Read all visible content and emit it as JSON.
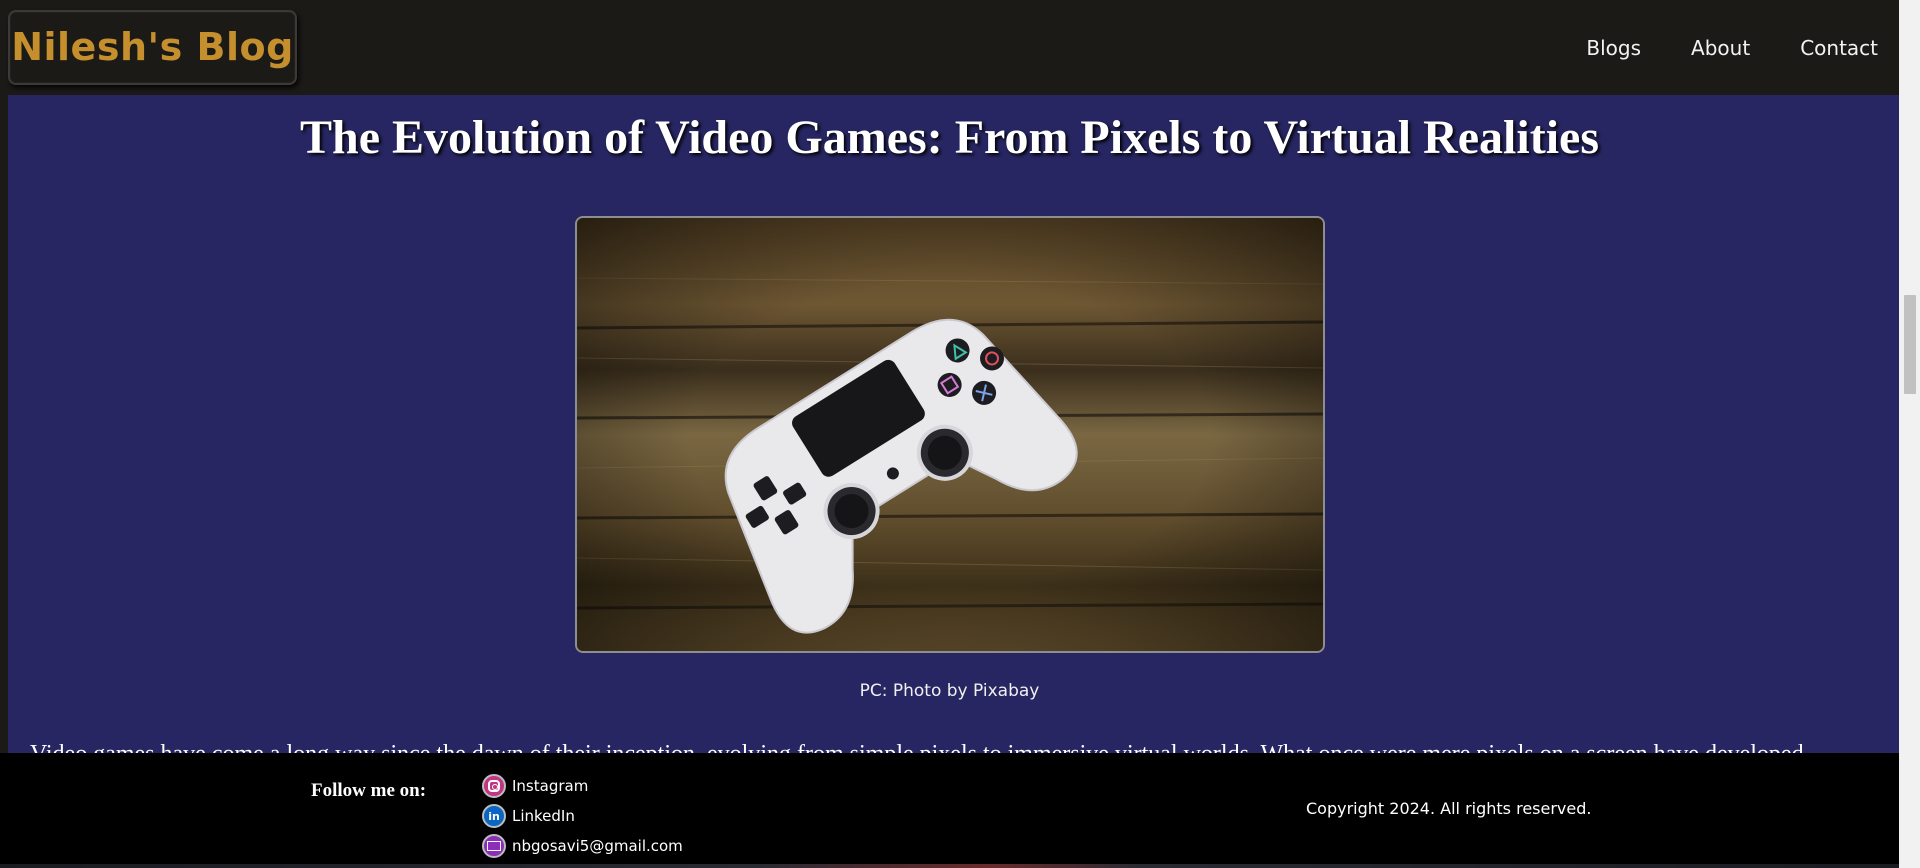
{
  "header": {
    "logo": "Nilesh's Blog",
    "nav": [
      {
        "label": "Blogs"
      },
      {
        "label": "About"
      },
      {
        "label": "Contact"
      }
    ]
  },
  "article": {
    "title": "The Evolution of Video Games: From Pixels to Virtual Realities",
    "image_alt": "White game controller on a wooden table",
    "caption": "PC: Photo by Pixabay",
    "body_cut_text": "Video games have come a long way since the dawn of their inception, evolving from simple pixels to immersive virtual worlds. What once were mere pixels on a screen have developed"
  },
  "footer": {
    "follow_label": "Follow me on:",
    "social": [
      {
        "label": "Instagram",
        "icon": "instagram-icon"
      },
      {
        "label": "LinkedIn",
        "icon": "linkedin-icon"
      },
      {
        "label": "nbgosavi5@gmail.com",
        "icon": "mail-icon"
      }
    ],
    "copyright": "Copyright 2024. All rights reserved."
  },
  "colors": {
    "page_bg": "#272662",
    "header_bg": "#1b1a17",
    "logo": "#c48f2c",
    "footer_bg": "#000000"
  }
}
